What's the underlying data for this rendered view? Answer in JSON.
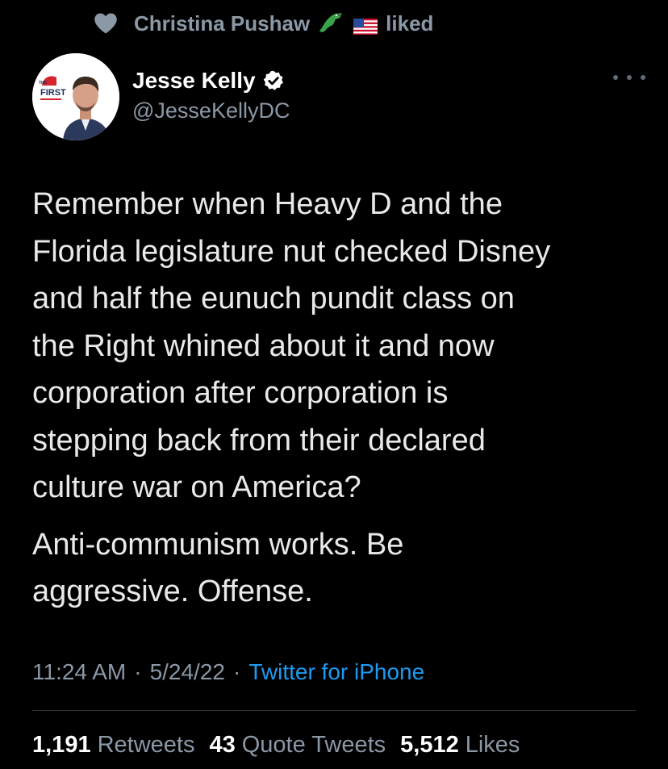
{
  "social_context": {
    "liker_name": "Christina Pushaw",
    "action_label": "liked",
    "icons": [
      "heart-icon",
      "alligator-icon",
      "us-flag-icon"
    ]
  },
  "author": {
    "display_name": "Jesse Kelly",
    "handle": "@JesseKellyDC",
    "verified": true,
    "avatar_badge_text": "THE FIRST"
  },
  "tweet": {
    "paragraphs": [
      "Remember when Heavy D and the\nFlorida legislature nut checked Disney\nand half the eunuch pundit class on\nthe Right whined about it and now\ncorporation after corporation is\nstepping back from their declared\nculture war on America?",
      "Anti-communism works. Be\naggressive. Offense."
    ],
    "time": "11:24 AM",
    "date": "5/24/22",
    "separator": "·",
    "source": "Twitter for iPhone"
  },
  "stats": {
    "retweets_count": "1,191",
    "retweets_label": "Retweets",
    "quotes_count": "43",
    "quotes_label": "Quote Tweets",
    "likes_count": "5,512",
    "likes_label": "Likes"
  },
  "colors": {
    "background": "#000000",
    "text": "#e7e9ea",
    "secondary": "#8b98a5",
    "accent": "#1d9bf0",
    "verified": "#ffffff"
  }
}
